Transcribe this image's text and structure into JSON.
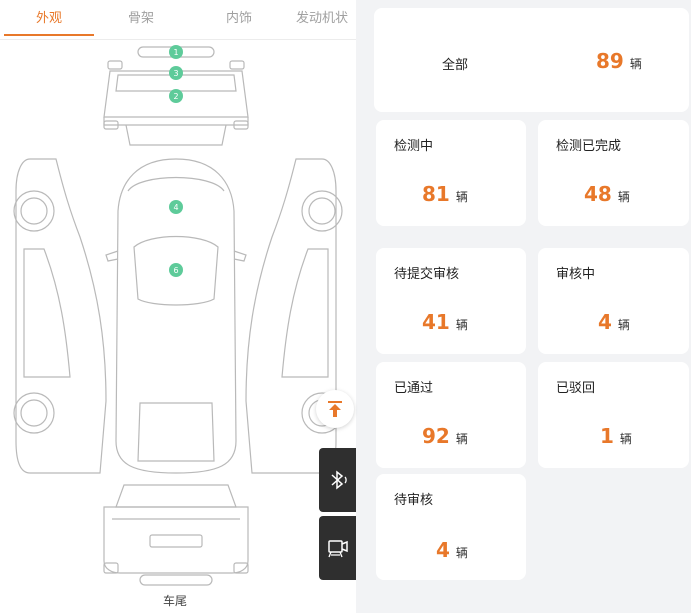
{
  "tabs": [
    {
      "label": "外观",
      "active": true
    },
    {
      "label": "骨架",
      "active": false
    },
    {
      "label": "内饰",
      "active": false
    },
    {
      "label": "发动机状",
      "active": false
    }
  ],
  "diagram": {
    "markers": [
      "1",
      "3",
      "2",
      "4",
      "6"
    ],
    "rear_label": "车尾"
  },
  "icons": {
    "fab": "scroll-to-top-icon",
    "bluetooth": "bluetooth-icon",
    "vehicle_camera": "vehicle-camera-icon"
  },
  "stats": {
    "total": {
      "label": "全部",
      "value": "89",
      "unit": "辆"
    },
    "inspecting": {
      "label": "检测中",
      "value": "81",
      "unit": "辆"
    },
    "inspected": {
      "label": "检测已完成",
      "value": "48",
      "unit": "辆"
    },
    "pending_submit": {
      "label": "待提交审核",
      "value": "41",
      "unit": "辆"
    },
    "reviewing": {
      "label": "审核中",
      "value": "4",
      "unit": "辆"
    },
    "passed": {
      "label": "已通过",
      "value": "92",
      "unit": "辆"
    },
    "rejected": {
      "label": "已驳回",
      "value": "1",
      "unit": "辆"
    },
    "pending_review": {
      "label": "待审核",
      "value": "4",
      "unit": "辆"
    }
  },
  "colors": {
    "accent": "#e8782a",
    "marker": "#5ecb9a",
    "dark_button": "#2f2f2f",
    "outline": "#b9b9b9"
  }
}
